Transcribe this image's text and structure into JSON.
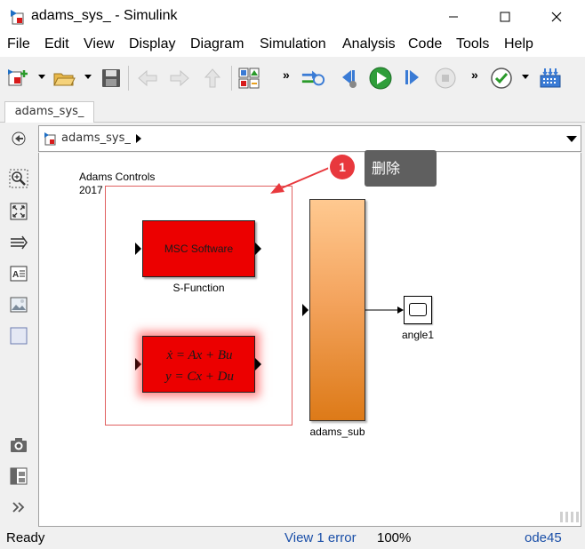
{
  "window": {
    "title": "adams_sys_ - Simulink",
    "minimize_icon": "minimize-icon",
    "maximize_icon": "maximize-icon",
    "close_icon": "close-icon"
  },
  "menu": {
    "items": [
      "File",
      "Edit",
      "View",
      "Display",
      "Diagram",
      "Simulation",
      "Analysis",
      "Code",
      "Tools",
      "Help"
    ]
  },
  "toolbar": {
    "buttons": [
      "new-model-icon",
      "open-folder-icon",
      "save-icon",
      "back-icon",
      "forward-icon",
      "up-icon",
      "library-browser-icon",
      "update-diagram-icon",
      "step-back-icon",
      "run-icon",
      "step-forward-icon",
      "stop-icon",
      "model-advisor-icon",
      "build-icon"
    ],
    "more_glyph": "»"
  },
  "tab": {
    "label": "adams_sys_"
  },
  "address": {
    "path": "adams_sys_"
  },
  "palette": {
    "tools": [
      "hide-browser-icon",
      "zoom-icon",
      "fit-view-icon",
      "arrow-connect-icon",
      "annotation-icon",
      "image-icon",
      "area-icon",
      "camera-icon",
      "model-browser-icon",
      "more-icon"
    ]
  },
  "diagram": {
    "annotation_line1": "Adams Controls",
    "annotation_line2": "2017",
    "sfunction_text": "MSC Software",
    "sfunction_name": "S-Function",
    "statespace_eq1": "ẋ = Ax + Bu",
    "statespace_eq2": "y = Cx + Du",
    "subsystem_name": "adams_sub",
    "scope_name": "angle1",
    "colors": {
      "block_red": "#ec0000",
      "subsystem_orange": "#f4a45e",
      "area_border": "#e06060",
      "callout_red": "#e8383d"
    }
  },
  "callout": {
    "number": "1",
    "text": "删除"
  },
  "status": {
    "ready": "Ready",
    "error_link": "View 1 error",
    "zoom": "100%",
    "solver": "ode45"
  }
}
